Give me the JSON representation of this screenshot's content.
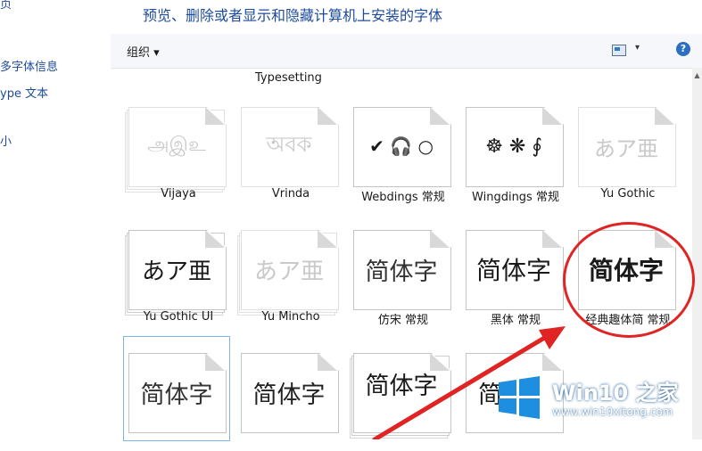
{
  "left_pane": {
    "links": [
      "页",
      "多字体信息",
      "ype 文本",
      "小"
    ]
  },
  "title": "预览、删除或者显示和隐藏计算机上安装的字体",
  "toolbar": {
    "organize": "组织 ▾",
    "view_caret": "▾",
    "help": "?"
  },
  "prev_row_label": "Typesetting",
  "fonts_row1": [
    {
      "name": "Vijaya",
      "sample": "அஇஉ",
      "hidden": true
    },
    {
      "name": "Vrinda",
      "sample": "অবক",
      "hidden": true
    },
    {
      "name": "Webdings 常规",
      "sample": "✔ 🎧 ○",
      "hidden": false
    },
    {
      "name": "Wingdings 常规",
      "sample": "☸ ❋ ∮",
      "hidden": false
    },
    {
      "name": "Yu Gothic",
      "sample": "あア亜",
      "hidden": true
    }
  ],
  "fonts_row2": [
    {
      "name": "Yu Gothic UI",
      "sample": "あア亜",
      "hidden": false
    },
    {
      "name": "Yu Mincho",
      "sample": "あア亜",
      "hidden": true
    },
    {
      "name": "仿宋 常规",
      "sample": "简体字",
      "hidden": false
    },
    {
      "name": "黑体 常规",
      "sample": "简体字",
      "hidden": false
    },
    {
      "name": "经典趣体简 常规",
      "sample": "简体字",
      "hidden": false
    }
  ],
  "fonts_row3": [
    {
      "name": "",
      "sample": "简体字"
    },
    {
      "name": "",
      "sample": "简体字"
    },
    {
      "name": "",
      "sample": "简体字"
    },
    {
      "name": "",
      "sample": "简"
    }
  ],
  "watermark": {
    "brand": "Win10 之家",
    "url": "www.win10xitong.com"
  },
  "colors": {
    "accent": "#1e4b9b",
    "annotation": "#e02424",
    "selection": "#7fb6e8"
  }
}
